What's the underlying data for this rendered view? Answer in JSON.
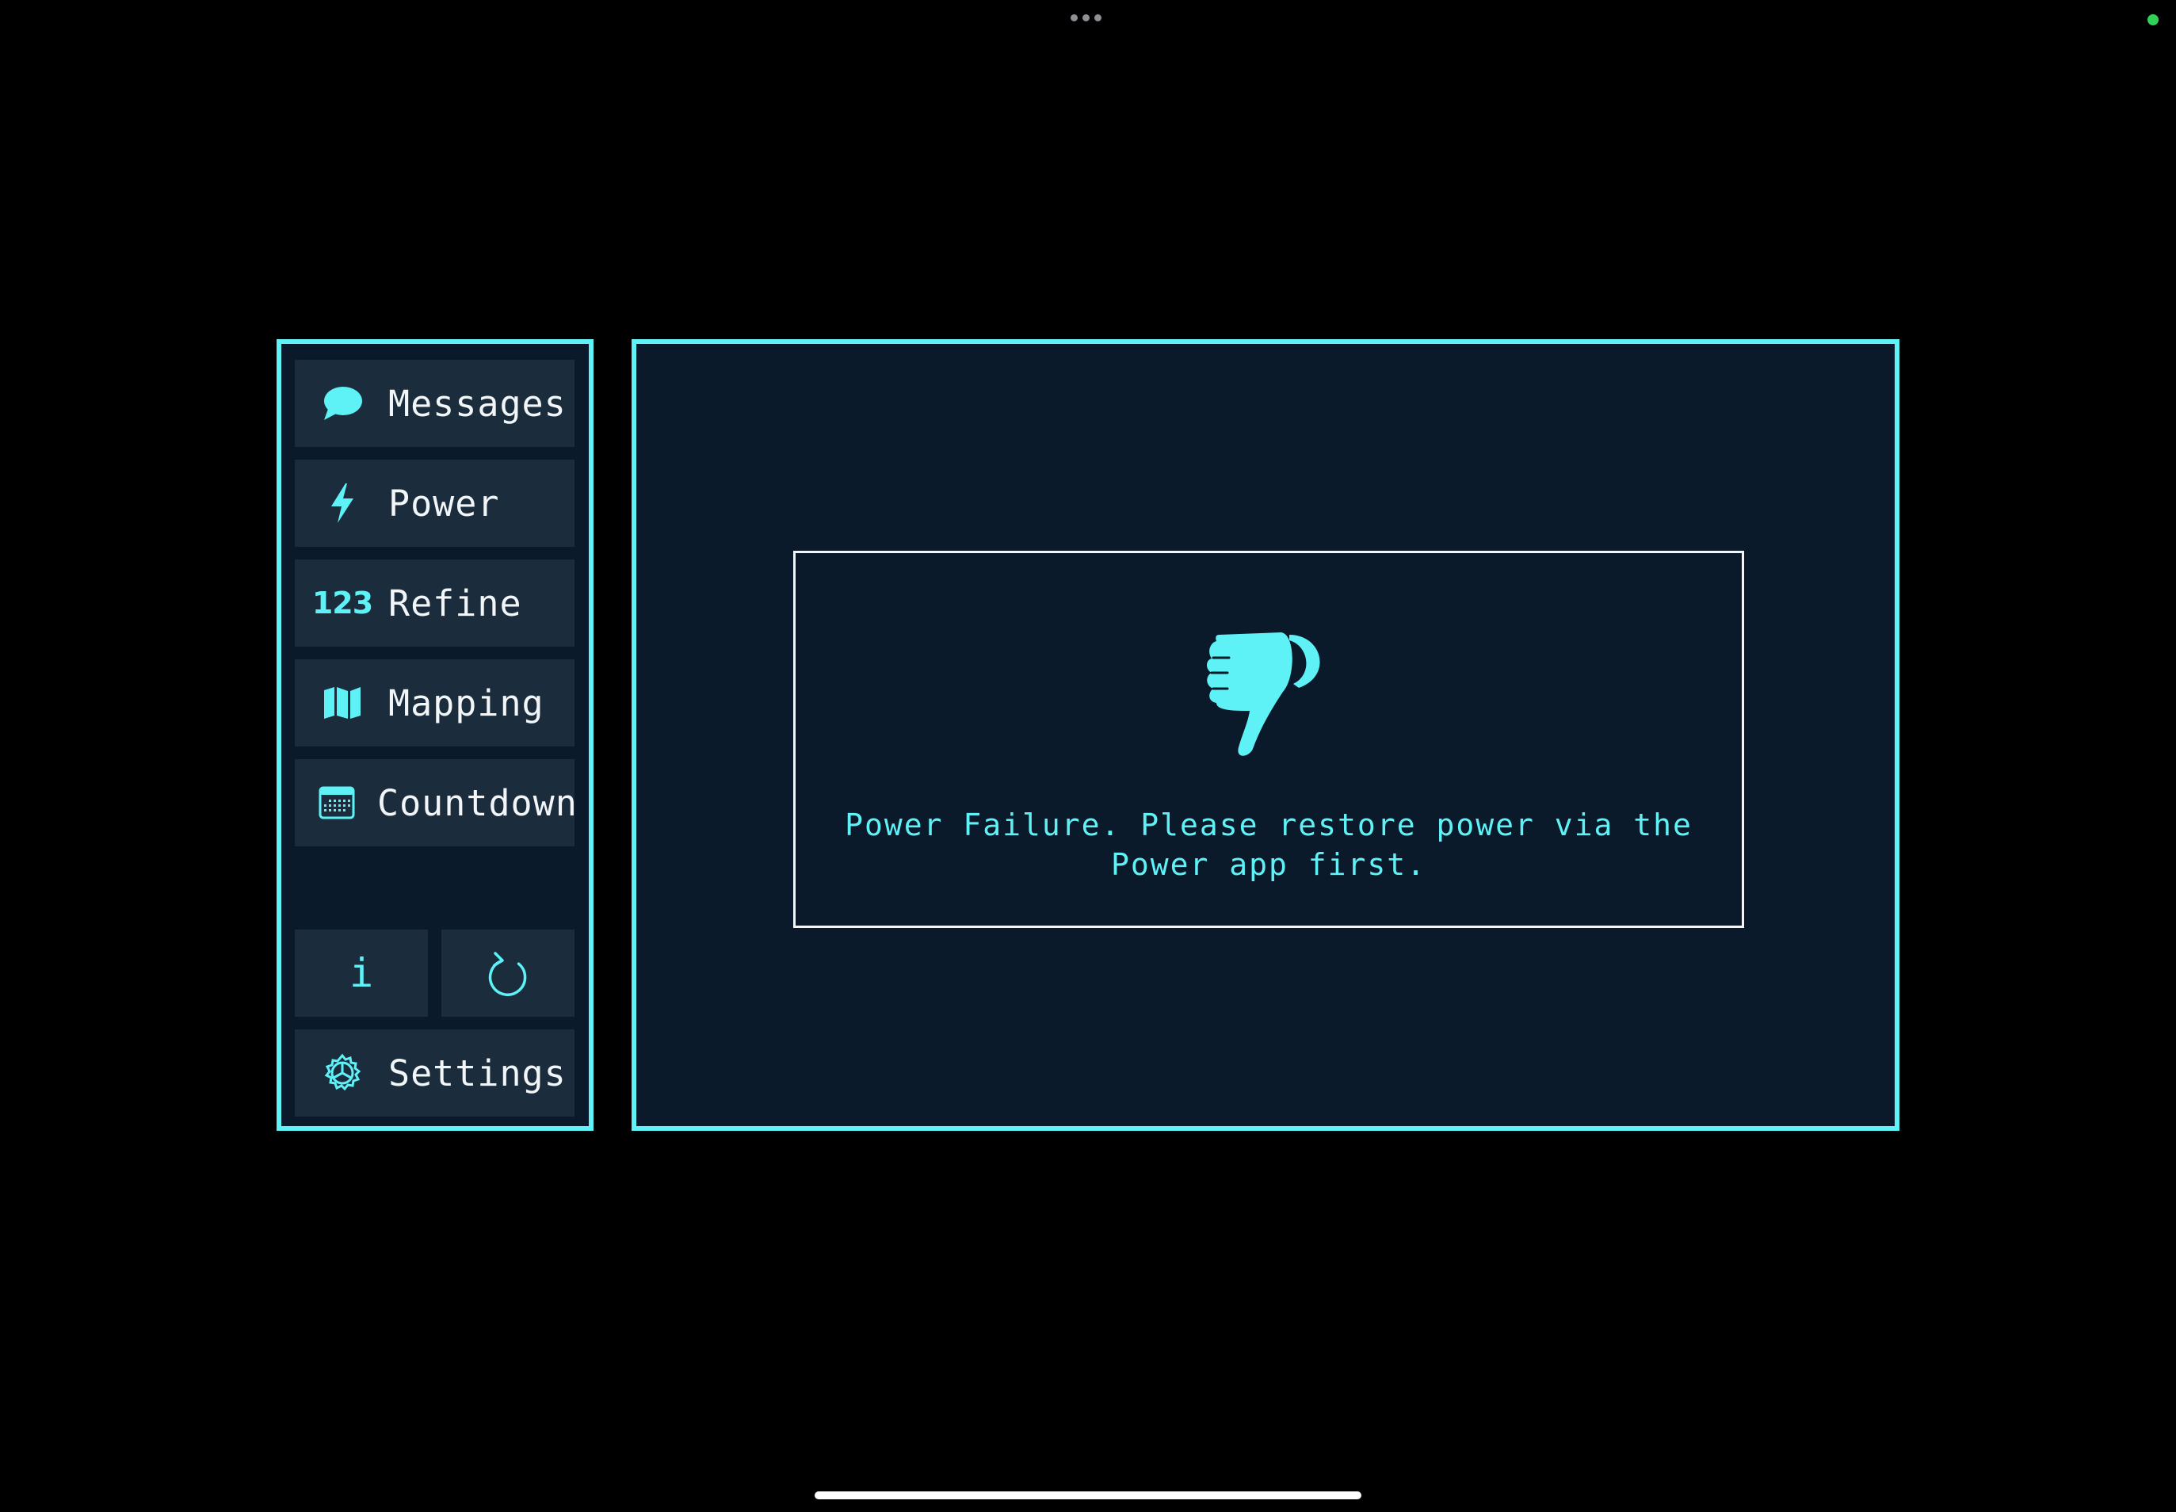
{
  "sidebar": {
    "items": [
      {
        "label": "Messages",
        "icon": "speech-bubble-icon"
      },
      {
        "label": "Power",
        "icon": "bolt-icon"
      },
      {
        "label": "Refine",
        "icon": "numbers-123-icon",
        "icon_text": "123"
      },
      {
        "label": "Mapping",
        "icon": "map-icon"
      },
      {
        "label": "Countdown",
        "icon": "calendar-icon"
      }
    ],
    "info_button": {
      "glyph": "i",
      "icon": "info-icon"
    },
    "refresh_button": {
      "icon": "refresh-icon"
    },
    "settings": {
      "label": "Settings",
      "icon": "gear-icon"
    }
  },
  "main": {
    "alert": {
      "icon": "thumbs-down-icon",
      "message": "Power Failure. Please restore power via the Power app first."
    }
  },
  "colors": {
    "accent": "#5ef2f7",
    "panel_bg": "#0a1a2a",
    "button_bg": "#1b2d3d",
    "text": "#f2f6f8",
    "background": "#000000",
    "status_dot": "#30d158"
  }
}
